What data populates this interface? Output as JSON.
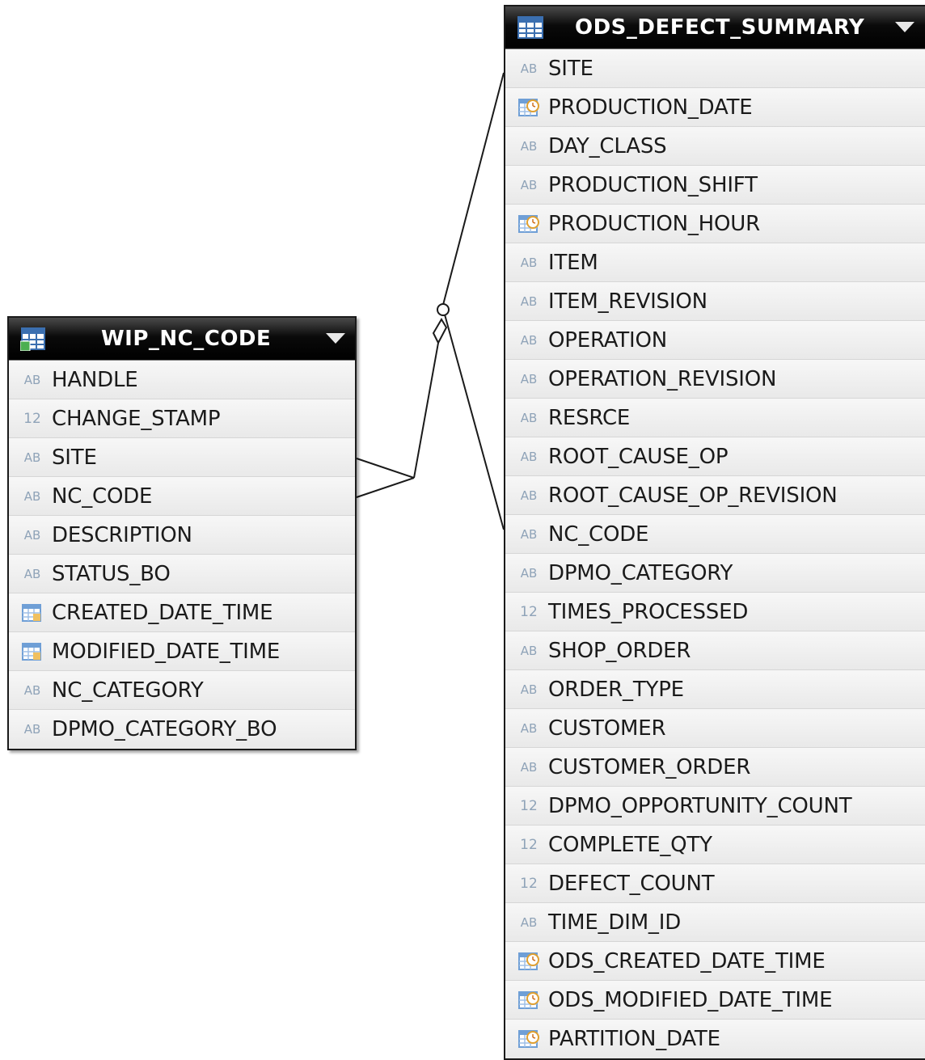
{
  "entities": {
    "wip": {
      "name": "WIP_NC_CODE",
      "columns": [
        {
          "name": "HANDLE",
          "type": "string",
          "type_label": "AB"
        },
        {
          "name": "CHANGE_STAMP",
          "type": "number",
          "type_label": "12"
        },
        {
          "name": "SITE",
          "type": "string",
          "type_label": "AB"
        },
        {
          "name": "NC_CODE",
          "type": "string",
          "type_label": "AB"
        },
        {
          "name": "DESCRIPTION",
          "type": "string",
          "type_label": "AB"
        },
        {
          "name": "STATUS_BO",
          "type": "string",
          "type_label": "AB"
        },
        {
          "name": "CREATED_DATE_TIME",
          "type": "datetime",
          "type_label": ""
        },
        {
          "name": "MODIFIED_DATE_TIME",
          "type": "datetime",
          "type_label": ""
        },
        {
          "name": "NC_CATEGORY",
          "type": "string",
          "type_label": "AB"
        },
        {
          "name": "DPMO_CATEGORY_BO",
          "type": "string",
          "type_label": "AB"
        }
      ]
    },
    "ods": {
      "name": "ODS_DEFECT_SUMMARY",
      "columns": [
        {
          "name": "SITE",
          "type": "string",
          "type_label": "AB"
        },
        {
          "name": "PRODUCTION_DATE",
          "type": "date",
          "type_label": ""
        },
        {
          "name": "DAY_CLASS",
          "type": "string",
          "type_label": "AB"
        },
        {
          "name": "PRODUCTION_SHIFT",
          "type": "string",
          "type_label": "AB"
        },
        {
          "name": "PRODUCTION_HOUR",
          "type": "date",
          "type_label": ""
        },
        {
          "name": "ITEM",
          "type": "string",
          "type_label": "AB"
        },
        {
          "name": "ITEM_REVISION",
          "type": "string",
          "type_label": "AB"
        },
        {
          "name": "OPERATION",
          "type": "string",
          "type_label": "AB"
        },
        {
          "name": "OPERATION_REVISION",
          "type": "string",
          "type_label": "AB"
        },
        {
          "name": "RESRCE",
          "type": "string",
          "type_label": "AB"
        },
        {
          "name": "ROOT_CAUSE_OP",
          "type": "string",
          "type_label": "AB"
        },
        {
          "name": "ROOT_CAUSE_OP_REVISION",
          "type": "string",
          "type_label": "AB"
        },
        {
          "name": "NC_CODE",
          "type": "string",
          "type_label": "AB"
        },
        {
          "name": "DPMO_CATEGORY",
          "type": "string",
          "type_label": "AB"
        },
        {
          "name": "TIMES_PROCESSED",
          "type": "number",
          "type_label": "12"
        },
        {
          "name": "SHOP_ORDER",
          "type": "string",
          "type_label": "AB"
        },
        {
          "name": "ORDER_TYPE",
          "type": "string",
          "type_label": "AB"
        },
        {
          "name": "CUSTOMER",
          "type": "string",
          "type_label": "AB"
        },
        {
          "name": "CUSTOMER_ORDER",
          "type": "string",
          "type_label": "AB"
        },
        {
          "name": "DPMO_OPPORTUNITY_COUNT",
          "type": "number",
          "type_label": "12"
        },
        {
          "name": "COMPLETE_QTY",
          "type": "number",
          "type_label": "12"
        },
        {
          "name": "DEFECT_COUNT",
          "type": "number",
          "type_label": "12"
        },
        {
          "name": "TIME_DIM_ID",
          "type": "string",
          "type_label": "AB"
        },
        {
          "name": "ODS_CREATED_DATE_TIME",
          "type": "date",
          "type_label": ""
        },
        {
          "name": "ODS_MODIFIED_DATE_TIME",
          "type": "date",
          "type_label": ""
        },
        {
          "name": "PARTITION_DATE",
          "type": "date",
          "type_label": ""
        }
      ]
    }
  },
  "relationship": {
    "from": "WIP_NC_CODE",
    "to": "ODS_DEFECT_SUMMARY",
    "from_columns": [
      "SITE",
      "NC_CODE"
    ],
    "to_columns": [
      "SITE",
      "NC_CODE"
    ],
    "markers": [
      "crow-foot",
      "optional-circle",
      "diamond"
    ]
  },
  "colors": {
    "header_bg": "#000000",
    "row_bg": "#ededed",
    "icon_text": "#8fa3b8",
    "datetime_icon": "#6f9fd6",
    "clock_icon": "#e0a030"
  }
}
